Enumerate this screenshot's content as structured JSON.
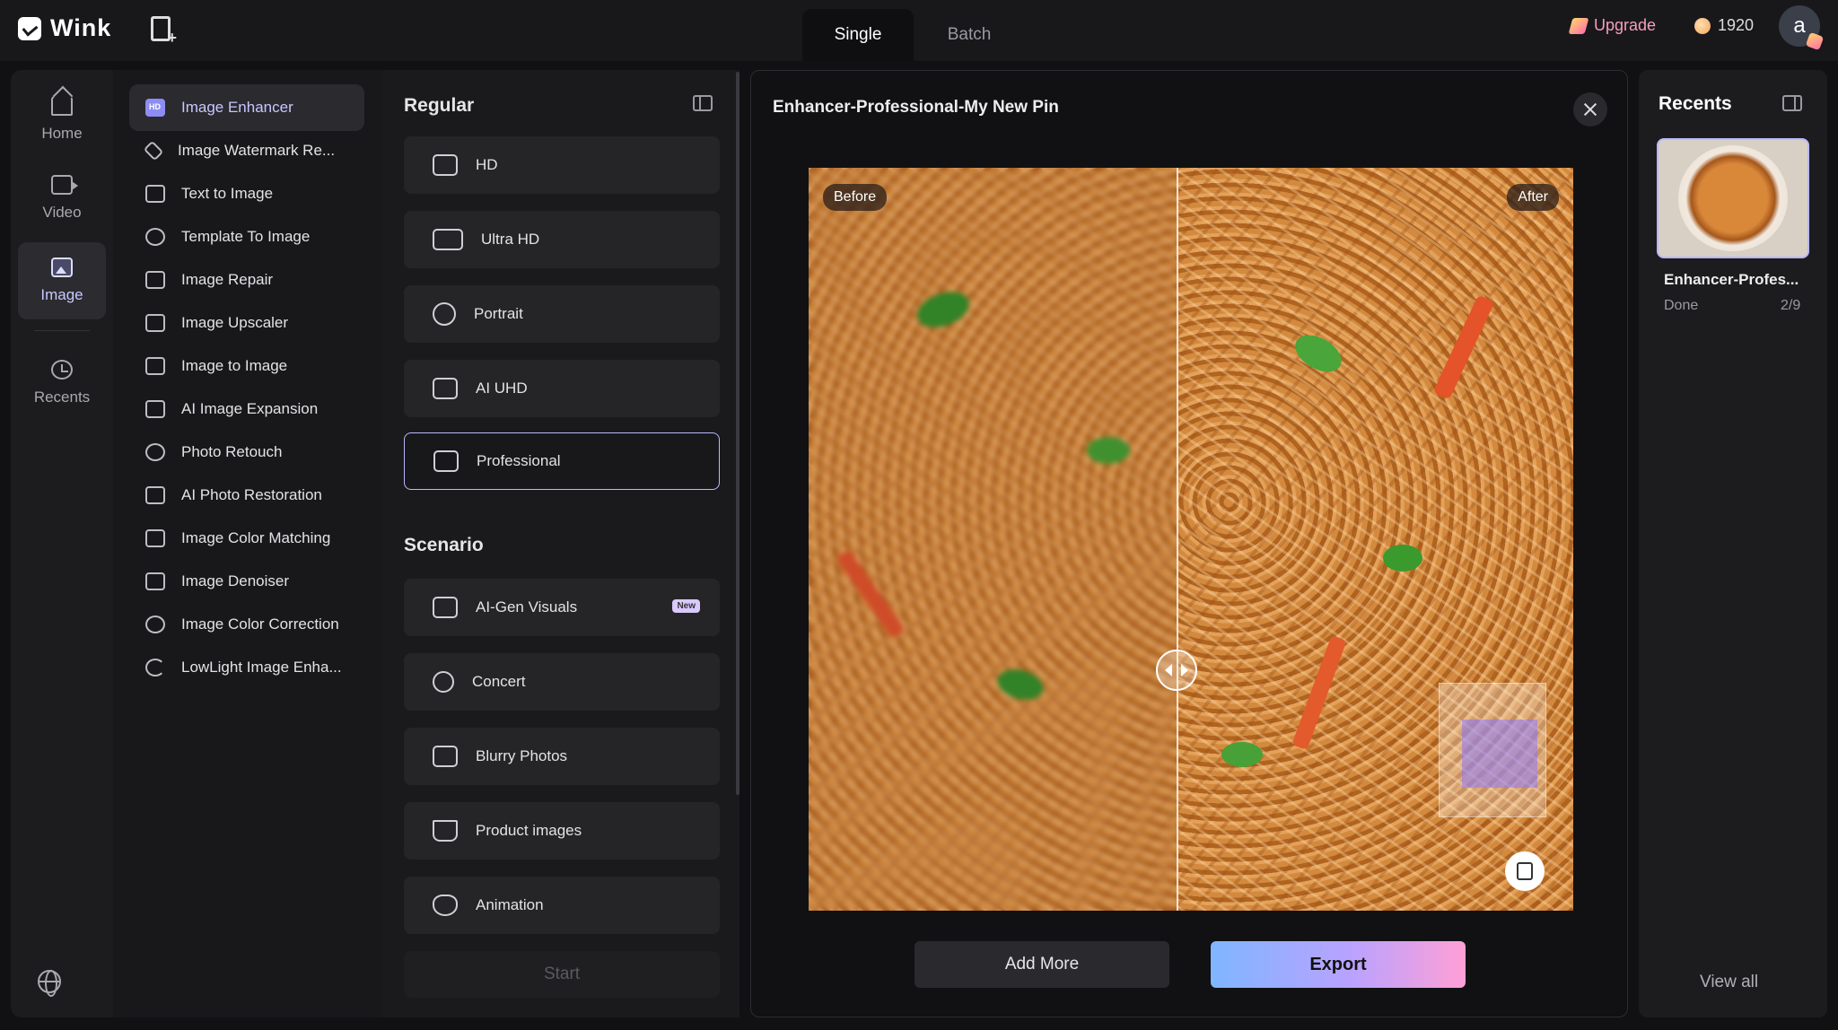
{
  "app": {
    "name": "Wink"
  },
  "top_tabs": [
    {
      "label": "Single",
      "active": true
    },
    {
      "label": "Batch",
      "active": false
    }
  ],
  "upgrade_label": "Upgrade",
  "credits": "1920",
  "avatar_letter": "a",
  "rail": [
    {
      "label": "Home",
      "icon": "home-icon"
    },
    {
      "label": "Video",
      "icon": "video-icon"
    },
    {
      "label": "Image",
      "icon": "image-icon",
      "active": true
    },
    {
      "label": "Recents",
      "icon": "history-icon"
    }
  ],
  "tools": [
    {
      "label": "Image Enhancer",
      "active": true
    },
    {
      "label": "Image Watermark Re..."
    },
    {
      "label": "Text to Image"
    },
    {
      "label": "Template To Image"
    },
    {
      "label": "Image Repair"
    },
    {
      "label": "Image Upscaler"
    },
    {
      "label": "Image to Image"
    },
    {
      "label": "AI Image Expansion"
    },
    {
      "label": "Photo Retouch"
    },
    {
      "label": "AI Photo Restoration"
    },
    {
      "label": "Image Color Matching"
    },
    {
      "label": "Image Denoiser"
    },
    {
      "label": "Image Color Correction"
    },
    {
      "label": "LowLight Image Enha..."
    }
  ],
  "options": {
    "regular_title": "Regular",
    "regular": [
      {
        "label": "HD"
      },
      {
        "label": "Ultra HD"
      },
      {
        "label": "Portrait"
      },
      {
        "label": "AI UHD"
      },
      {
        "label": "Professional",
        "selected": true
      }
    ],
    "scenario_title": "Scenario",
    "scenario": [
      {
        "label": "AI-Gen Visuals",
        "badge": "New"
      },
      {
        "label": "Concert"
      },
      {
        "label": "Blurry Photos"
      },
      {
        "label": "Product images"
      },
      {
        "label": "Animation"
      }
    ],
    "start_label": "Start"
  },
  "preview": {
    "title": "Enhancer-Professional-My New Pin",
    "before_label": "Before",
    "after_label": "After",
    "add_more_label": "Add More",
    "export_label": "Export"
  },
  "recents": {
    "title": "Recents",
    "item": {
      "name": "Enhancer-Profes...",
      "status": "Done",
      "count": "2/9"
    },
    "view_all_label": "View all"
  },
  "colors": {
    "accent": "#b9b7ff",
    "upgrade": "#f59fb8"
  }
}
